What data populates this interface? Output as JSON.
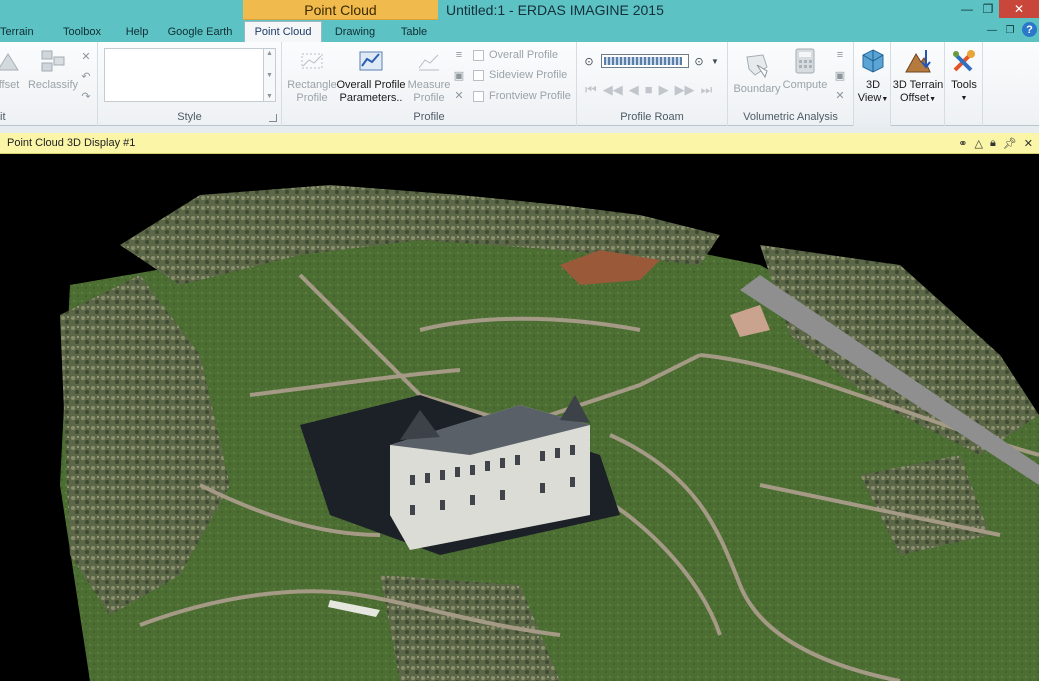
{
  "window": {
    "context_group": "Point Cloud",
    "title": "Untitled:1 - ERDAS IMAGINE 2015",
    "minimize": "—",
    "restore": "❐",
    "close": "✕",
    "help_min": "—",
    "help_restore": "❐",
    "help": "?"
  },
  "tabs": [
    {
      "label": "Terrain",
      "active": false
    },
    {
      "label": "Toolbox",
      "active": false
    },
    {
      "label": "Help",
      "active": false
    },
    {
      "label": "Google Earth",
      "active": false
    },
    {
      "label": "Point Cloud",
      "active": true
    },
    {
      "label": "Drawing",
      "active": false
    },
    {
      "label": "Table",
      "active": false
    }
  ],
  "ribbon": {
    "edit_group": {
      "label": "it",
      "offset": "ffset",
      "reclassify": "Reclassify"
    },
    "style_group": {
      "label": "Style"
    },
    "profile_group": {
      "label": "Profile",
      "rectangle_profile": [
        "Rectangle",
        "Profile"
      ],
      "overall_profile_parameters": [
        "Overall Profile",
        "Parameters.."
      ],
      "measure_profile": [
        "Measure",
        "Profile"
      ],
      "checks": [
        "Overall Profile",
        "Sideview Profile",
        "Frontview Profile"
      ]
    },
    "profile_roam_group": {
      "label": "Profile Roam",
      "slider_fraction": 0.95
    },
    "volumetric_group": {
      "label": "Volumetric Analysis",
      "boundary": "Boundary",
      "compute": "Compute"
    },
    "view3d": [
      "3D",
      "View"
    ],
    "terrain_offset": [
      "3D Terrain",
      "Offset"
    ],
    "tools": "Tools"
  },
  "viewer": {
    "title": "Point Cloud 3D Display #1"
  },
  "colors": {
    "titlebar": "#5cc2c4",
    "context_tab": "#f1ba4d",
    "view_header": "#fbf5a8"
  }
}
